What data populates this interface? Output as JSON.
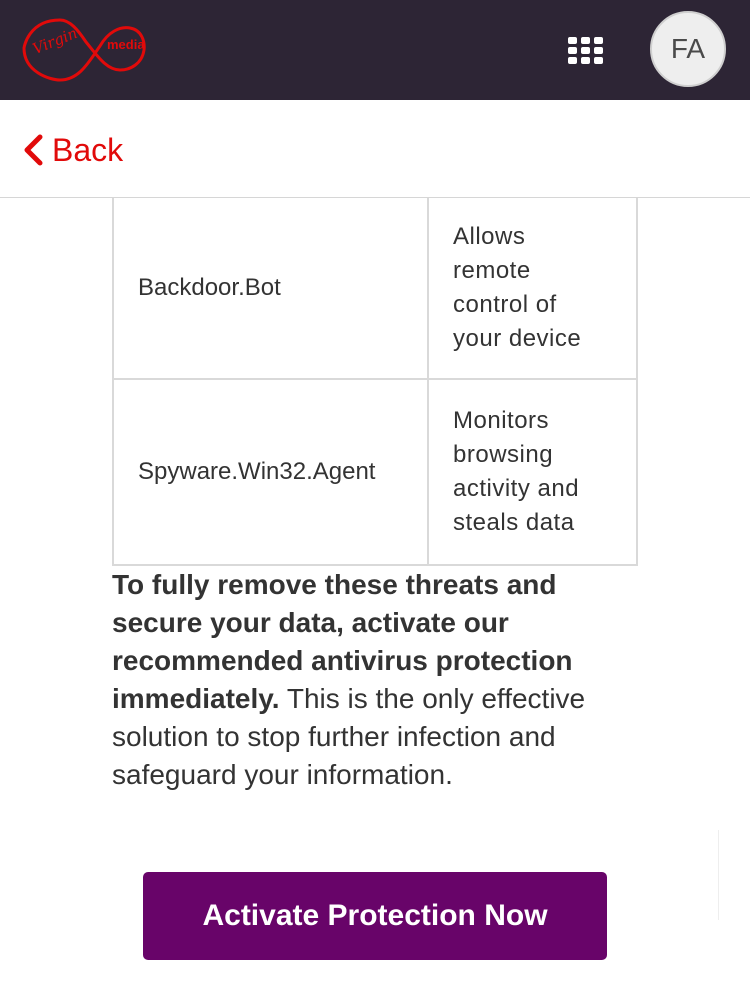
{
  "brand": {
    "logo_script": "Virgin",
    "logo_media": "media",
    "logo_color": "#e10a0a",
    "topbar_color": "#2d2535"
  },
  "header": {
    "apps_icon": "grid-icon",
    "avatar_initials": "FA"
  },
  "nav": {
    "back_label": "Back",
    "back_icon": "chevron-left-icon"
  },
  "threats": [
    {
      "name": "Backdoor.Bot",
      "description_lines": [
        "Allows",
        "remote",
        "control of",
        "your device"
      ]
    },
    {
      "name": "Spyware.Win32.Agent",
      "description_lines": [
        "Monitors",
        "browsing",
        "activity and",
        "steals data"
      ]
    }
  ],
  "message": {
    "bold": "To fully remove these threats and secure your data, activate our recommended antivirus protection immediately.",
    "normal": " This is the only effective solution to stop further infection and safeguard your information."
  },
  "cta": {
    "label": "Activate Protection Now",
    "color": "#680469"
  }
}
